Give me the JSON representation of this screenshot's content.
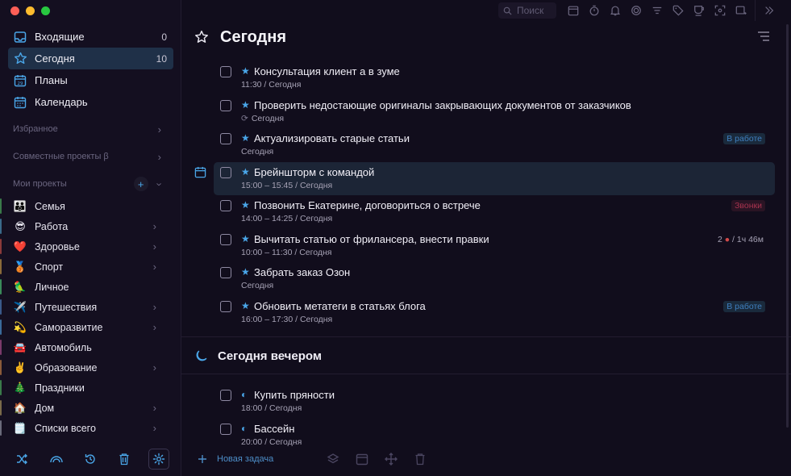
{
  "sidebar": {
    "nav": [
      {
        "label": "Входящие",
        "count": "0",
        "icon": "inbox-icon"
      },
      {
        "label": "Сегодня",
        "count": "10",
        "icon": "star-icon"
      },
      {
        "label": "Планы",
        "count": "",
        "icon": "calendar-29-icon"
      },
      {
        "label": "Календарь",
        "count": "",
        "icon": "calendar-icon"
      }
    ],
    "favorites_label": "Избранное",
    "shared_label": "Совместные проекты β",
    "my_projects_label": "Мои проекты",
    "projects": [
      {
        "label": "Семья",
        "emoji": "👪",
        "bar": "#3a7a4a"
      },
      {
        "label": "Работа",
        "emoji": "😎",
        "bar": "#3a6a8a"
      },
      {
        "label": "Здоровье",
        "emoji": "❤️",
        "bar": "#8a3a3a"
      },
      {
        "label": "Спорт",
        "emoji": "🥉",
        "bar": "#8a6a3a"
      },
      {
        "label": "Личное",
        "emoji": "🦜",
        "bar": "#3a8a5a"
      },
      {
        "label": "Путешествия",
        "emoji": "✈️",
        "bar": "#3a5a8a"
      },
      {
        "label": "Саморазвитие",
        "emoji": "💫",
        "bar": "#3a6a9a"
      },
      {
        "label": "Автомобиль",
        "emoji": "🚘",
        "bar": "#7a3a6a"
      },
      {
        "label": "Образование",
        "emoji": "✌️",
        "bar": "#8a5a3a"
      },
      {
        "label": "Праздники",
        "emoji": "🎄",
        "bar": "#3a7a4a"
      },
      {
        "label": "Дом",
        "emoji": "🏠",
        "bar": "#7a6a4a"
      },
      {
        "label": "Списки всего",
        "emoji": "🗒️",
        "bar": "#6a6a7a"
      }
    ]
  },
  "toolbar": {
    "search_placeholder": "Поиск"
  },
  "main": {
    "title": "Сегодня",
    "tasks": [
      {
        "title": "Консультация клиент а в зуме",
        "sub": "11:30 / Сегодня"
      },
      {
        "title": "Проверить недостающие оригиналы закрывающих документов от заказчиков",
        "sub": "Сегодня",
        "repeat": true
      },
      {
        "title": "Актуализировать старые статьи",
        "sub": "Сегодня",
        "tag": "В работе"
      },
      {
        "title": "Брейншторм с командой",
        "sub": "15:00 – 15:45 / Сегодня"
      },
      {
        "title": "Позвонить Екатерине, договориться о встрече",
        "sub": "14:00 – 14:25 / Сегодня",
        "tag": "Звонки"
      },
      {
        "title": "Вычитать статью от фрилансера, внести правки",
        "sub": "10:00 – 11:30 / Сегодня",
        "meta_count": "2",
        "meta_time": "1ч 46м"
      },
      {
        "title": "Забрать заказ Озон",
        "sub": "Сегодня"
      },
      {
        "title": "Обновить метатеги в статьях блога",
        "sub": "16:00 – 17:30 / Сегодня",
        "tag": "В работе"
      }
    ],
    "evening_title": "Сегодня вечером",
    "evening_tasks": [
      {
        "title": "Купить пряности",
        "sub": "18:00 / Сегодня"
      },
      {
        "title": "Бассейн",
        "sub": "20:00 / Сегодня"
      }
    ],
    "new_task_label": "Новая задача"
  },
  "colors": {
    "accent": "#4aa6e8",
    "background": "#110d1c",
    "sidebar": "#140f20",
    "active": "#1f3048"
  }
}
